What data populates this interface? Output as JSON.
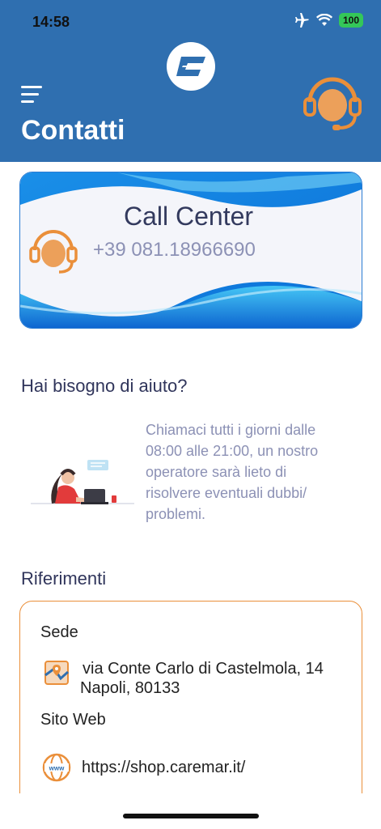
{
  "status_bar": {
    "time": "14:58",
    "battery": "100"
  },
  "header": {
    "title": "Contatti",
    "menu_icon": "hamburger-menu-icon",
    "support_icon": "headset-icon",
    "logo": "caremar-logo"
  },
  "call_center": {
    "title": "Call Center",
    "phone": "+39 081.18966690"
  },
  "help": {
    "title": "Hai bisogno di aiuto?",
    "text_lines": [
      "Chiamaci tutti i giorni dalle",
      "08:00 alle 21:00, un nostro",
      "operatore sarà lieto di",
      "risolvere eventuali dubbi/",
      "problemi."
    ]
  },
  "references": {
    "title": "Riferimenti",
    "sede_label": "Sede",
    "address_line1": "via Conte Carlo di Castelmola, 14",
    "address_line2": "Napoli, 80133",
    "web_label": "Sito Web",
    "web_url": "https://shop.caremar.it/"
  },
  "colors": {
    "header_bg": "#2f6fb0",
    "accent_orange": "#ea8f3a",
    "text_dark": "#30355b",
    "text_muted": "#8c91b5"
  }
}
